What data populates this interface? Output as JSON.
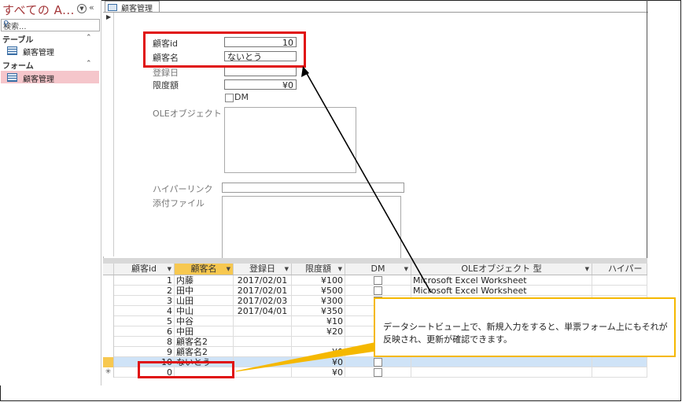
{
  "nav": {
    "title": "すべての A...",
    "search_placeholder": "検索...",
    "groups": [
      {
        "label": "テーブル",
        "items": [
          "顧客管理"
        ]
      },
      {
        "label": "フォーム",
        "items": [
          "顧客管理"
        ]
      }
    ]
  },
  "tab": {
    "label": "顧客管理"
  },
  "form": {
    "id_label": "顧客id",
    "id_value": "10",
    "name_label": "顧客名",
    "name_value": "ないとう",
    "date_label": "登録日",
    "date_value": "",
    "limit_label": "限度額",
    "limit_value": "¥0",
    "dm_label": "DM",
    "ole_label": "OLEオブジェクト 型",
    "link_label": "ハイパーリンク",
    "attach_label": "添付ファイル"
  },
  "datasheet": {
    "headers": [
      "顧客id",
      "顧客名",
      "登録日",
      "限度額",
      "DM",
      "OLEオブジェクト 型",
      "ハイパー"
    ],
    "rows": [
      {
        "id": "1",
        "name": "内藤",
        "date": "2017/02/01",
        "limit": "¥100",
        "ole": "Microsoft Excel Worksheet"
      },
      {
        "id": "2",
        "name": "田中",
        "date": "2017/02/01",
        "limit": "¥500",
        "ole": "Microsoft Excel Worksheet"
      },
      {
        "id": "3",
        "name": "山田",
        "date": "2017/02/03",
        "limit": "¥300",
        "ole": ""
      },
      {
        "id": "4",
        "name": "中山",
        "date": "2017/04/01",
        "limit": "¥350",
        "ole": ""
      },
      {
        "id": "5",
        "name": "中谷",
        "date": "",
        "limit": "¥10",
        "ole": ""
      },
      {
        "id": "6",
        "name": "中田",
        "date": "",
        "limit": "¥20",
        "ole": ""
      },
      {
        "id": "8",
        "name": "顧客名2",
        "date": "",
        "limit": "",
        "ole": ""
      },
      {
        "id": "9",
        "name": "顧客名2",
        "date": "",
        "limit": "¥0",
        "ole": ""
      },
      {
        "id": "10",
        "name": "ないとう",
        "date": "",
        "limit": "¥0",
        "ole": ""
      },
      {
        "id": "0",
        "name": "",
        "date": "",
        "limit": "¥0",
        "ole": ""
      }
    ]
  },
  "callout": {
    "text": "データシートビュー上で、新規入力をすると、単票フォーム上にもそれが反映され、更新が確認できます。"
  },
  "colors": {
    "highlight_red": "#e01010",
    "callout_yellow": "#f5b800",
    "selected_header": "#f7c850",
    "nav_selected": "#f5c6cb"
  }
}
